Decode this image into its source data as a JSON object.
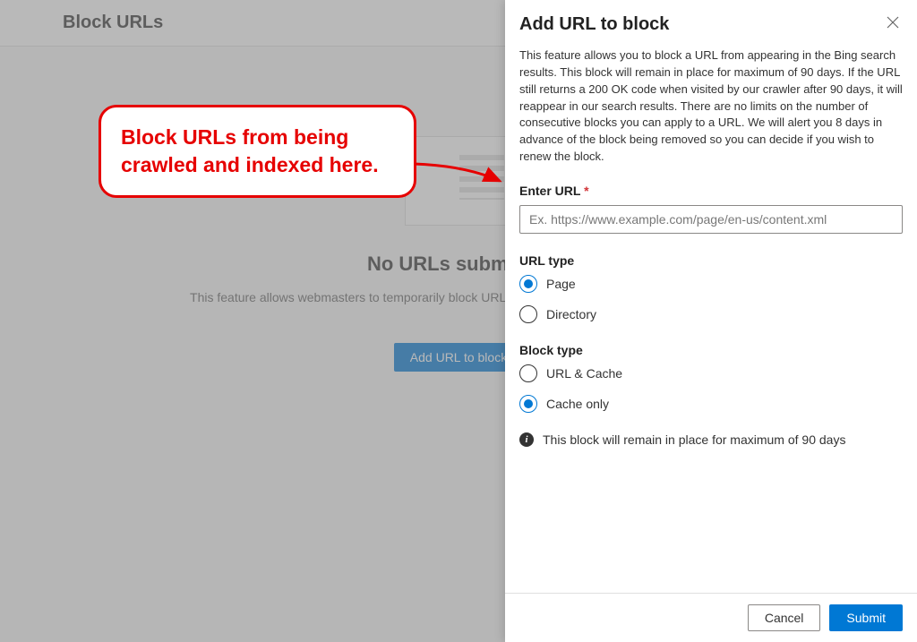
{
  "background": {
    "title": "Block URLs",
    "empty_heading": "No URLs submitted",
    "empty_sub": "This feature allows webmasters to temporarily block URLs from appearing in Bing search results.",
    "cta": "Add URL to block"
  },
  "annotation": {
    "text": "Block URLs from being crawled and indexed here."
  },
  "panel": {
    "title": "Add URL to block",
    "description": "This feature allows you to block a URL from appearing in the Bing search results. This block will remain in place for maximum of 90 days. If the URL still returns a 200 OK code when visited by our crawler after 90 days, it will reappear in our search results. There are no limits on the number of consecutive blocks you can apply to a URL. We will alert you 8 days in advance of the block being removed so you can decide if you wish to renew the block.",
    "url_field": {
      "label": "Enter URL",
      "required_mark": "*",
      "placeholder": "Ex. https://www.example.com/page/en-us/content.xml"
    },
    "url_type": {
      "label": "URL type",
      "options": [
        {
          "label": "Page",
          "selected": true
        },
        {
          "label": "Directory",
          "selected": false
        }
      ]
    },
    "block_type": {
      "label": "Block type",
      "options": [
        {
          "label": "URL & Cache",
          "selected": false
        },
        {
          "label": "Cache only",
          "selected": true
        }
      ]
    },
    "info_note": "This block will remain in place for maximum of 90 days",
    "footer": {
      "cancel": "Cancel",
      "submit": "Submit"
    }
  }
}
